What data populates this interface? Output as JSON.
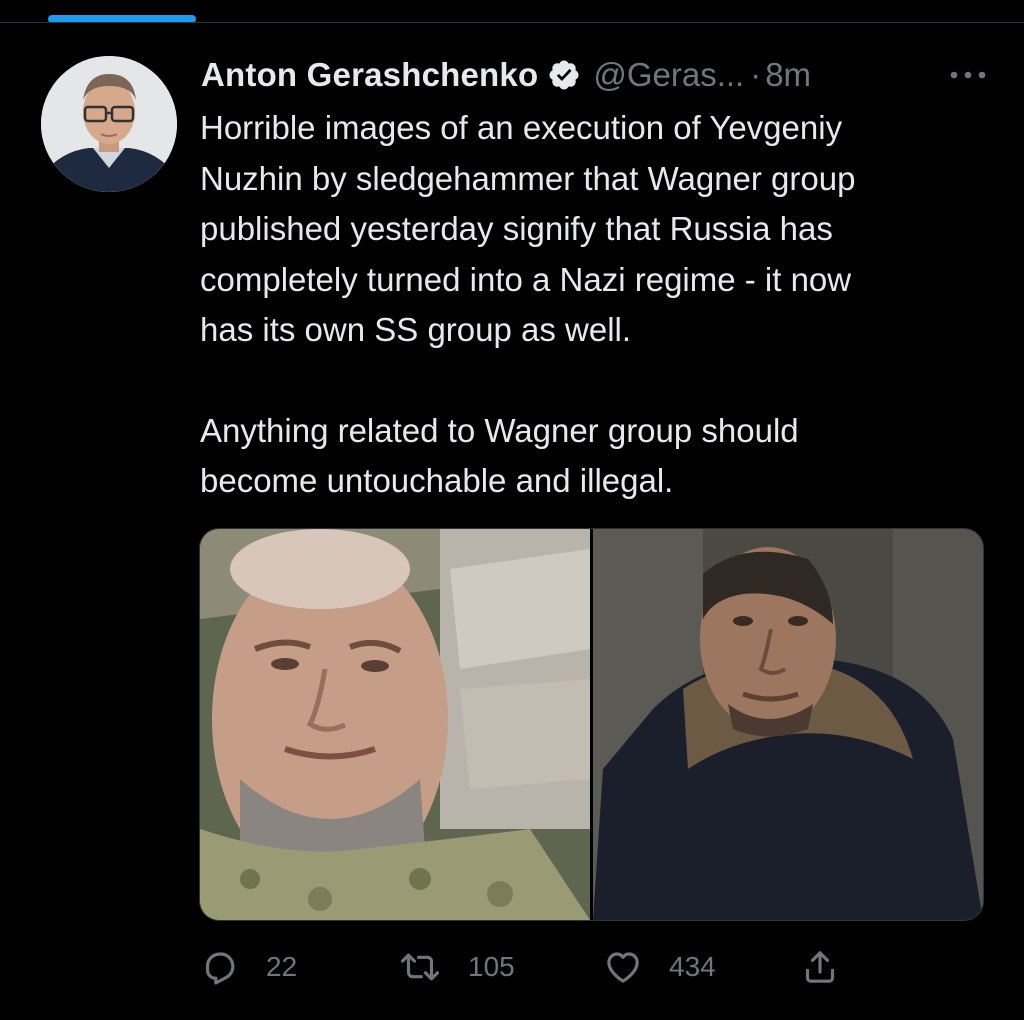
{
  "tweet": {
    "author_name": "Anton Gerashchenko",
    "handle": "@Geras...",
    "separator": "·",
    "time": "8m",
    "text_paragraphs": [
      "Horrible images of an execution of Yevgeniy\nNuzhin by sledgehammer that Wagner group\npublished yesterday signify that Russia has\ncompletely turned into a Nazi regime - it now\nhas its own SS group as well.",
      "Anything related to Wagner group should\nbecome untouchable and illegal."
    ],
    "media_count": 2,
    "icons": {
      "verified": "verified-badge-icon",
      "more": "more-options-icon",
      "reply": "reply-icon",
      "retweet": "retweet-icon",
      "like": "like-icon",
      "share": "share-icon"
    }
  },
  "actions": {
    "reply_count": "22",
    "retweet_count": "105",
    "like_count": "434"
  },
  "colors": {
    "background": "#000000",
    "text_primary": "#e7e9ea",
    "text_secondary": "#71767b",
    "accent": "#1d9bf0",
    "divider": "#2f3336"
  }
}
